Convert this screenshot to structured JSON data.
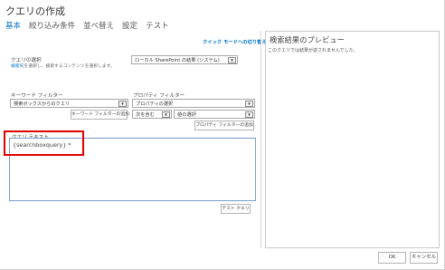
{
  "dialog": {
    "title": "クエリの作成"
  },
  "tabs": [
    {
      "label": "基本"
    },
    {
      "label": "絞り込み条件"
    },
    {
      "label": "並べ替え"
    },
    {
      "label": "設定"
    },
    {
      "label": "テスト"
    }
  ],
  "quick_link": "クイック モードへの切り替え",
  "query_select": {
    "label": "クエリの選択",
    "hint_link": "検索先",
    "hint_rest": "を選択し、検索するコンテンツを選択します。",
    "value": "ローカル SharePoint の結果 (システム)"
  },
  "keyword_filter": {
    "label": "キーワード フィルター",
    "value": "検索ボックスからのクエリ",
    "add_button": "キーワード フィルターの追加"
  },
  "property_filter": {
    "label": "プロパティ フィルター",
    "property_value": "プロパティの選択",
    "operator_value": "次を含む",
    "value_select": "値の選択",
    "add_button": "プロパティ フィルターの追加"
  },
  "query_text": {
    "label": "クエリ テキスト",
    "value": "{searchboxquery} *"
  },
  "test_button": "テスト クエリ",
  "preview": {
    "title": "検索結果のプレビュー",
    "message": "このクエリでは結果が返されませんでした。"
  },
  "footer": {
    "ok": "OK",
    "cancel": "キャンセル"
  },
  "colors": {
    "accent": "#0072c6",
    "highlight": "#e00000"
  }
}
